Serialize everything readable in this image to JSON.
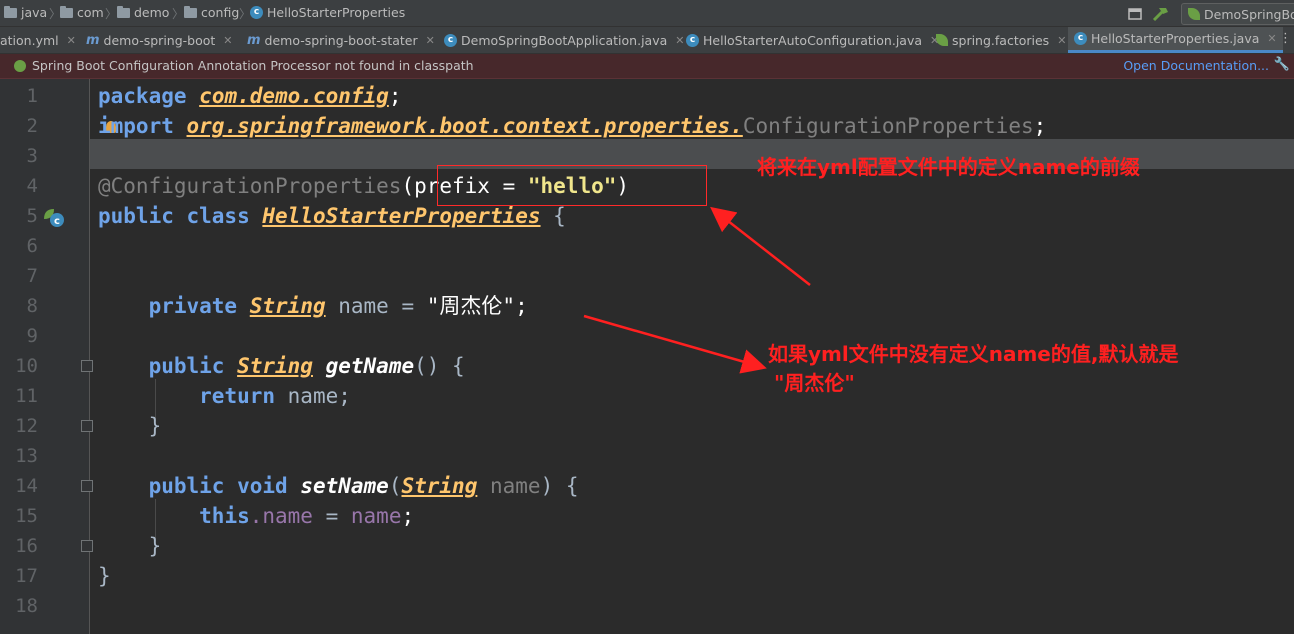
{
  "breadcrumb": {
    "items": [
      "java",
      "com",
      "demo",
      "config",
      "HelloStarterProperties"
    ],
    "run_config": "DemoSpringBo"
  },
  "tabs": [
    {
      "label": "ation.yml",
      "icon": "yaml-icon"
    },
    {
      "label": "demo-spring-boot",
      "icon": "maven-icon"
    },
    {
      "label": "demo-spring-boot-stater",
      "icon": "maven-icon"
    },
    {
      "label": "DemoSpringBootApplication.java",
      "icon": "spring-class-icon"
    },
    {
      "label": "HelloStarterAutoConfiguration.java",
      "icon": "class-icon"
    },
    {
      "label": "spring.factories",
      "icon": "spring-leaf-icon"
    },
    {
      "label": "HelloStarterProperties.java",
      "icon": "class-icon",
      "active": true
    }
  ],
  "banner": {
    "message": "Spring Boot Configuration Annotation Processor not found in classpath",
    "link": "Open Documentation..."
  },
  "code": {
    "line_numbers": [
      "1",
      "2",
      "3",
      "4",
      "5",
      "6",
      "7",
      "8",
      "9",
      "10",
      "11",
      "12",
      "13",
      "14",
      "15",
      "16",
      "17",
      "18"
    ],
    "l1": {
      "kw": "package",
      "pkg": "com.demo.config",
      "end": ";"
    },
    "l2": {
      "kw": "import",
      "pkg": "org.springframework.boot.context.properties.",
      "cls": "ConfigurationProperties",
      "end": ";"
    },
    "l4": {
      "ann": "@ConfigurationProperties",
      "open": "(prefix = ",
      "val": "\"hello\"",
      "close": ")"
    },
    "l5": {
      "kw": "public class",
      "cls": "HelloStarterProperties",
      "end": " {"
    },
    "l8": {
      "kw": "private",
      "type": "String",
      "mid": " name = ",
      "val": "\"周杰伦\"",
      "end": ";"
    },
    "l10": {
      "kw": "public",
      "type": "String",
      "fn": "getName",
      "end": "() {"
    },
    "l11": {
      "kw": "return",
      "rest": " name;"
    },
    "l12": "}",
    "l14": {
      "kw": "public void",
      "fn": "setName",
      "open": "(",
      "type": "String",
      "param": " name",
      "end": ") {"
    },
    "l15": {
      "kw": "this",
      "fld": ".name",
      "mid": " = ",
      "param": "name",
      "end": ";"
    },
    "l16": "}",
    "l17": "}"
  },
  "annotations": {
    "note1": "将来在yml配置文件中的定义name的前缀",
    "note2_line1": "如果yml文件中没有定义name的值,默认就是",
    "note2_line2": "\"周杰伦\"",
    "color": "#ff2020"
  }
}
